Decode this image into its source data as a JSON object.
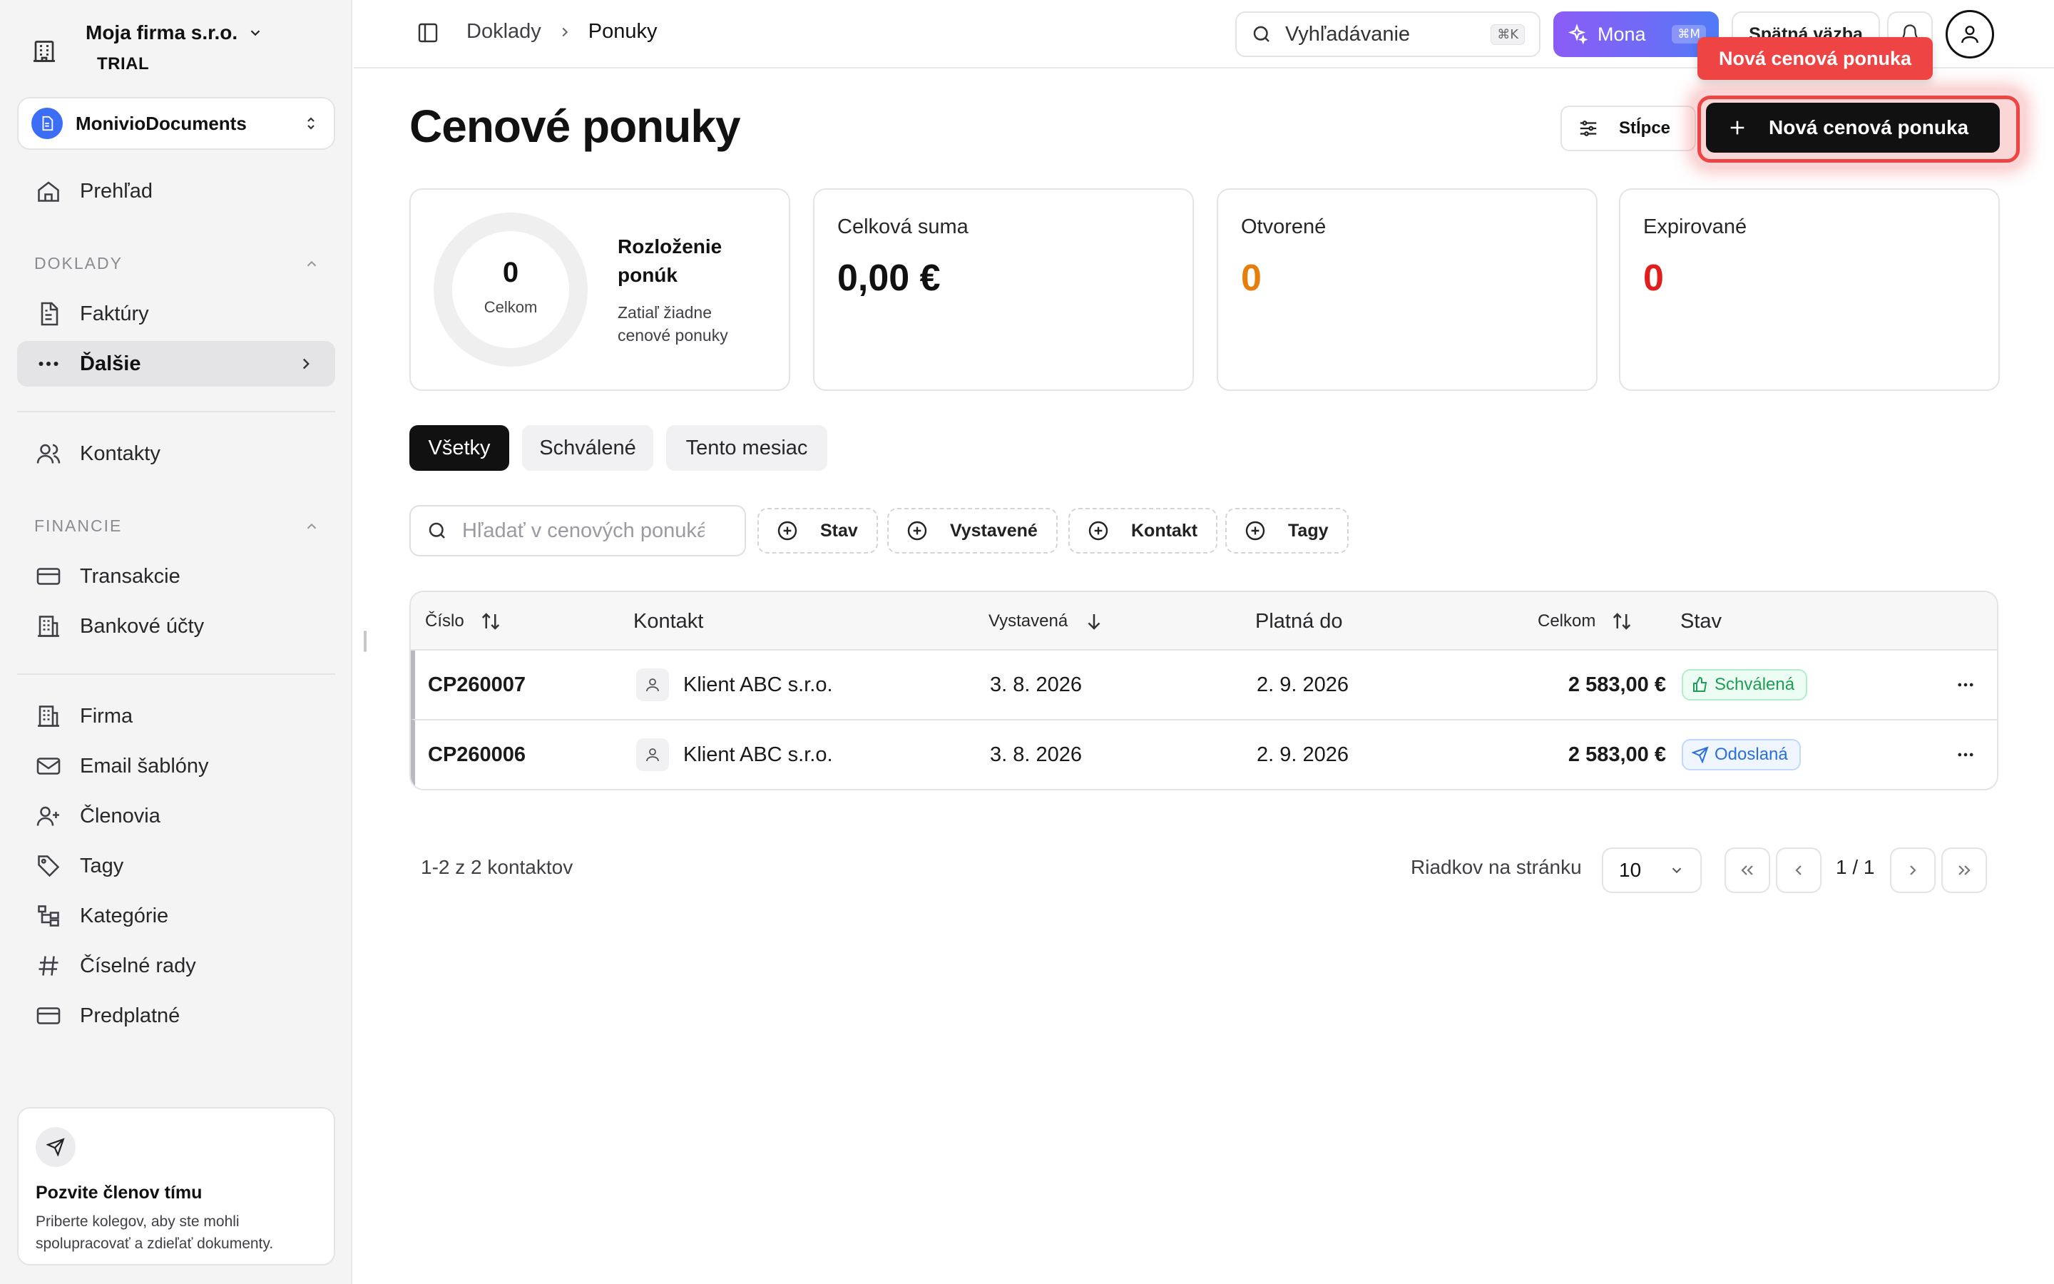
{
  "company": {
    "name": "Moja firma s.r.o.",
    "plan": "TRIAL"
  },
  "workspace": {
    "name": "MonivioDocuments"
  },
  "sidebar": {
    "overview": "Prehľad",
    "doklady_label": "DOKLADY",
    "invoices": "Faktúry",
    "more": "Ďalšie",
    "contacts": "Kontakty",
    "finance_label": "FINANCIE",
    "transactions": "Transakcie",
    "bank_accounts": "Bankové účty",
    "firm": "Firma",
    "email_templates": "Email šablóny",
    "members": "Členovia",
    "tags": "Tagy",
    "categories": "Kategórie",
    "number_series": "Číselné rady",
    "subscription": "Predplatné"
  },
  "invite": {
    "title": "Pozvite členov tímu",
    "description": "Priberte kolegov, aby ste mohli spolupracovať a zdieľať dokumenty."
  },
  "topbar": {
    "breadcrumb_parent": "Doklady",
    "breadcrumb_current": "Ponuky",
    "search_placeholder": "Vyhľadávanie",
    "search_shortcut": "⌘K",
    "mona_label": "Mona",
    "mona_shortcut": "⌘M",
    "feedback_label": "Spätná väzba"
  },
  "header": {
    "title": "Cenové ponuky",
    "columns_button": "Stĺpce",
    "new_button": "Nová cenová ponuka",
    "tooltip": "Nová cenová ponuka"
  },
  "stats": {
    "distribution_total": "0",
    "distribution_total_label": "Celkom",
    "distribution_title": "Rozloženie ponúk",
    "distribution_empty": "Zatiaľ žiadne cenové ponuky",
    "total_sum_label": "Celková suma",
    "total_sum_value": "0,00 €",
    "open_label": "Otvorené",
    "open_value": "0",
    "expired_label": "Expirované",
    "expired_value": "0"
  },
  "tabs": [
    "Všetky",
    "Schválené",
    "Tento mesiac"
  ],
  "filters": {
    "search_placeholder": "Hľadať v cenových ponukách",
    "chips": [
      "Stav",
      "Vystavené",
      "Kontakt",
      "Tagy"
    ]
  },
  "table": {
    "columns": {
      "number": "Číslo",
      "contact": "Kontakt",
      "issued": "Vystavená",
      "valid_until": "Platná do",
      "total": "Celkom",
      "status": "Stav"
    },
    "rows": [
      {
        "number": "CP260007",
        "contact": "Klient ABC s.r.o.",
        "issued": "3. 8. 2026",
        "valid_until": "2. 9. 2026",
        "total": "2 583,00 €",
        "status": "Schválená"
      },
      {
        "number": "CP260006",
        "contact": "Klient ABC s.r.o.",
        "issued": "3. 8. 2026",
        "valid_until": "2. 9. 2026",
        "total": "2 583,00 €",
        "status": "Odoslaná"
      }
    ]
  },
  "pagination": {
    "summary": "1-2 z 2 kontaktov",
    "rows_label": "Riadkov na stránku",
    "rows_value": "10",
    "page_info": "1 / 1"
  },
  "colors": {
    "accent": "#111111",
    "highlight": "#ef4444",
    "orange": "#e67e0c",
    "red": "#e01e1e",
    "green": "#1f9d55",
    "blue": "#2a6fdb"
  }
}
